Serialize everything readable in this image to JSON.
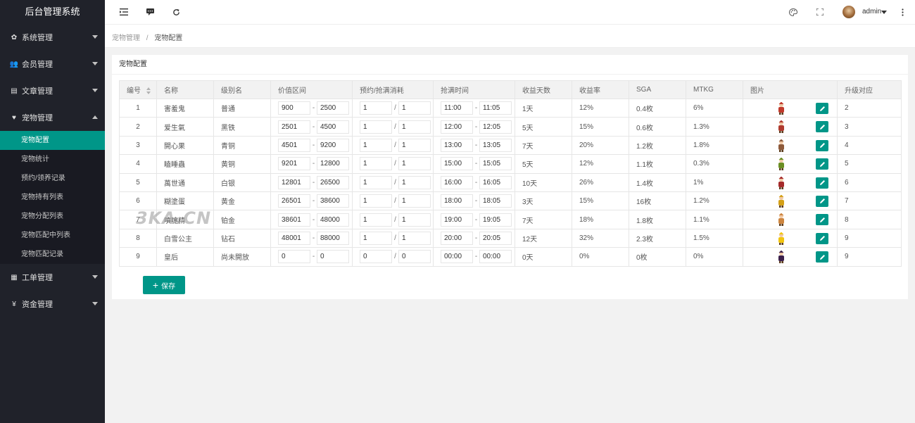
{
  "app": {
    "title": "后台管理系统"
  },
  "sidebar": {
    "items": [
      {
        "label": "系统管理",
        "icon": "gear-icon"
      },
      {
        "label": "会员管理",
        "icon": "users-icon"
      },
      {
        "label": "文章管理",
        "icon": "article-icon"
      },
      {
        "label": "宠物管理",
        "icon": "heart-icon"
      },
      {
        "label": "工单管理",
        "icon": "file-icon"
      },
      {
        "label": "资金管理",
        "icon": "yen-icon"
      }
    ],
    "pet_sub": [
      "宠物配置",
      "宠物统计",
      "预约/领养记录",
      "宠物持有列表",
      "宠物分配列表",
      "宠物匹配中列表",
      "宠物匹配记录"
    ]
  },
  "header": {
    "user": "admin"
  },
  "breadcrumb": {
    "parent": "宠物管理",
    "sep": "/",
    "current": "宠物配置"
  },
  "panel": {
    "title": "宠物配置"
  },
  "table": {
    "headers": [
      "编号",
      "名称",
      "级别名",
      "价值区间",
      "预约/抢满消耗",
      "抢满时间",
      "收益天数",
      "收益率",
      "SGA",
      "MTKG",
      "图片",
      "升级对应"
    ],
    "rows": [
      {
        "id": "1",
        "name": "害羞鬼",
        "level": "普通",
        "v1": "900",
        "v2": "2500",
        "c1": "1",
        "c2": "1",
        "t1": "11:00",
        "t2": "11:05",
        "days": "1天",
        "rate": "12%",
        "sga": "0.4枚",
        "mtkg": "6%",
        "up": "2",
        "color": "#c0392b"
      },
      {
        "id": "2",
        "name": "爱生氣",
        "level": "黑铁",
        "v1": "2501",
        "v2": "4500",
        "c1": "1",
        "c2": "1",
        "t1": "12:00",
        "t2": "12:05",
        "days": "5天",
        "rate": "15%",
        "sga": "0.6枚",
        "mtkg": "1.3%",
        "up": "3",
        "color": "#b03a2e"
      },
      {
        "id": "3",
        "name": "開心果",
        "level": "青铜",
        "v1": "4501",
        "v2": "9200",
        "c1": "1",
        "c2": "1",
        "t1": "13:00",
        "t2": "13:05",
        "days": "7天",
        "rate": "20%",
        "sga": "1.2枚",
        "mtkg": "1.8%",
        "up": "4",
        "color": "#8e5a3a"
      },
      {
        "id": "4",
        "name": "瞌睡蟲",
        "level": "黄铜",
        "v1": "9201",
        "v2": "12800",
        "c1": "1",
        "c2": "1",
        "t1": "15:00",
        "t2": "15:05",
        "days": "5天",
        "rate": "12%",
        "sga": "1.1枚",
        "mtkg": "0.3%",
        "up": "5",
        "color": "#6b8e23"
      },
      {
        "id": "5",
        "name": "萬世通",
        "level": "白银",
        "v1": "12801",
        "v2": "26500",
        "c1": "1",
        "c2": "1",
        "t1": "16:00",
        "t2": "16:05",
        "days": "10天",
        "rate": "26%",
        "sga": "1.4枚",
        "mtkg": "1%",
        "up": "6",
        "color": "#a52a2a"
      },
      {
        "id": "6",
        "name": "糊塗蛋",
        "level": "黄金",
        "v1": "26501",
        "v2": "38600",
        "c1": "1",
        "c2": "1",
        "t1": "18:00",
        "t2": "18:05",
        "days": "3天",
        "rate": "15%",
        "sga": "16枚",
        "mtkg": "1.2%",
        "up": "7",
        "color": "#d4a017"
      },
      {
        "id": "7",
        "name": "噴嚏精",
        "level": "铂金",
        "v1": "38601",
        "v2": "48000",
        "c1": "1",
        "c2": "1",
        "t1": "19:00",
        "t2": "19:05",
        "days": "7天",
        "rate": "18%",
        "sga": "1.8枚",
        "mtkg": "1.1%",
        "up": "8",
        "color": "#cd853f"
      },
      {
        "id": "8",
        "name": "白雪公主",
        "level": "钻石",
        "v1": "48001",
        "v2": "88000",
        "c1": "1",
        "c2": "1",
        "t1": "20:00",
        "t2": "20:05",
        "days": "12天",
        "rate": "32%",
        "sga": "2.3枚",
        "mtkg": "1.5%",
        "up": "9",
        "color": "#f1c40f"
      },
      {
        "id": "9",
        "name": "皇后",
        "level": "尚未開放",
        "v1": "0",
        "v2": "0",
        "c1": "0",
        "c2": "0",
        "t1": "00:00",
        "t2": "00:00",
        "days": "0天",
        "rate": "0%",
        "sga": "0枚",
        "mtkg": "0%",
        "up": "9",
        "color": "#3b1f4a"
      }
    ]
  },
  "actions": {
    "save_label": "保存",
    "range_sep": "-",
    "cost_sep": "/"
  },
  "watermark": "3KA.CN"
}
